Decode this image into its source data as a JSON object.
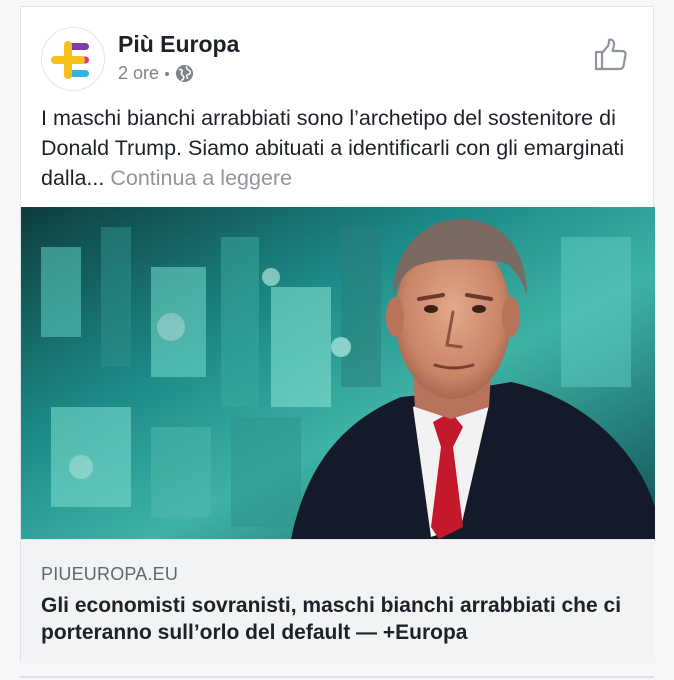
{
  "post": {
    "page_name": "Più Europa",
    "time": "2 ore",
    "privacy_icon": "globe-icon",
    "text": "I maschi bianchi arrabbiati sono l’archetipo del sostenitore di Donald Trump. Siamo abituati a identificarli con gli emarginati dalla...",
    "continue_label": "Continua a leggere",
    "like_icon": "thumbs-up-icon"
  },
  "link": {
    "domain": "PIUEUROPA.EU",
    "headline": "Gli economisti sovranisti, maschi bianchi arrabbiati che ci porteranno sull’orlo del default — +Europa"
  },
  "colors": {
    "logo_yellow": "#f6c01d",
    "logo_purple": "#7b3fa8",
    "logo_pink": "#e8328c",
    "logo_cyan": "#2eb7d9"
  }
}
